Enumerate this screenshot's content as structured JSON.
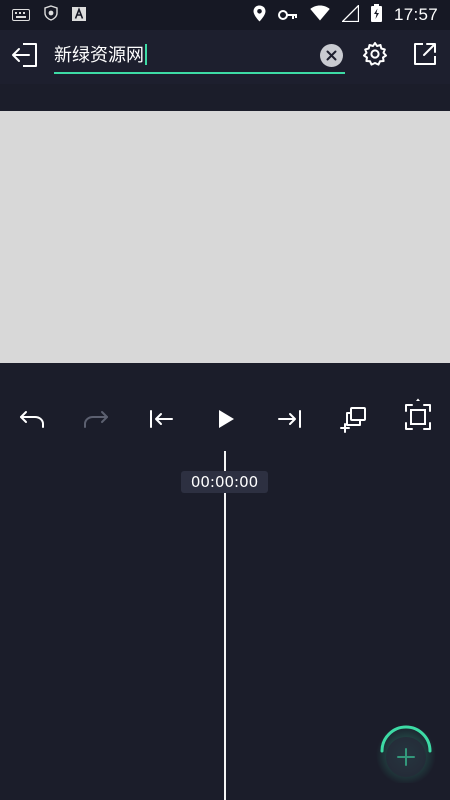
{
  "status_bar": {
    "time": "17:57",
    "left_icons": [
      "keyboard-icon",
      "shield-icon",
      "a-app-icon"
    ],
    "right_icons": [
      "location-icon",
      "key-icon",
      "wifi-icon",
      "signal-icon",
      "battery-icon"
    ]
  },
  "header": {
    "project_title": "新绿资源网",
    "icons": {
      "back": "exit-arrow-icon",
      "clear": "clear-x-icon",
      "settings": "gear-icon",
      "share": "export-icon"
    }
  },
  "toolbar": {
    "items": [
      {
        "name": "undo",
        "icon": "undo-icon",
        "enabled": true
      },
      {
        "name": "redo",
        "icon": "redo-icon",
        "enabled": false
      },
      {
        "name": "jump-to-start",
        "icon": "skip-start-icon",
        "enabled": true
      },
      {
        "name": "play",
        "icon": "play-icon",
        "enabled": true
      },
      {
        "name": "jump-to-end",
        "icon": "skip-end-icon",
        "enabled": true
      },
      {
        "name": "add-layer",
        "icon": "add-layer-icon",
        "enabled": true
      },
      {
        "name": "fullscreen",
        "icon": "fullscreen-icon",
        "enabled": true
      }
    ]
  },
  "timeline": {
    "timecode": "00:00:00"
  },
  "colors": {
    "background": "#1b1d2a",
    "accent": "#3ddba5",
    "preview": "#d8d8d8",
    "disabled": "#5c6070"
  }
}
